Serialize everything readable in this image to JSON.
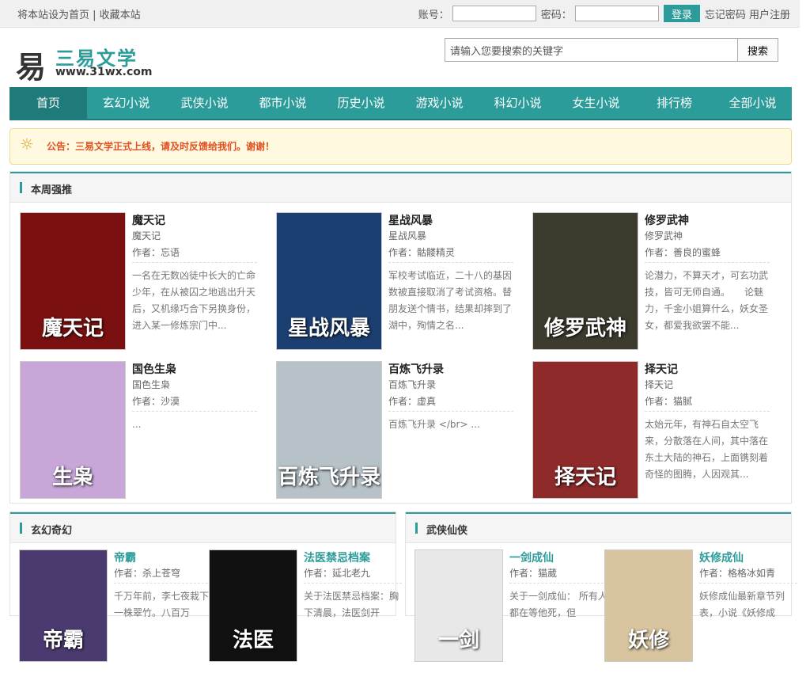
{
  "topbar": {
    "left_text_1": "将本站设为首页",
    "sep": " | ",
    "left_text_2": "收藏本站",
    "account_label": "账号：",
    "password_label": "密码：",
    "login_button": "登录",
    "forgot": "忘记密码",
    "register": "用户注册"
  },
  "logo": {
    "glyph": "易",
    "name": "三易文学",
    "url": "www.31wx.com"
  },
  "search": {
    "placeholder": "请输入您要搜索的关键字",
    "button": "搜索"
  },
  "nav": [
    "首页",
    "玄幻小说",
    "武侠小说",
    "都市小说",
    "历史小说",
    "游戏小说",
    "科幻小说",
    "女生小说",
    "排行榜",
    "全部小说"
  ],
  "notice": "公告：三易文学正式上线，请及时反馈给我们。谢谢！",
  "weekly": {
    "title": "本周强推",
    "books": [
      {
        "title": "魔天记",
        "sub": "魔天记",
        "author": "作者：忘语",
        "desc": "一名在无数凶徒中长大的亡命少年，在从被囚之地逃出升天后，又机缘巧合下另换身份，进入某一修炼宗门中...",
        "cover_text": "魔天记",
        "cover_color": "#7a1010"
      },
      {
        "title": "星战风暴",
        "sub": "星战风暴",
        "author": "作者：骷髅精灵",
        "desc": "军校考试临近，二十八的基因数被直接取消了考试资格。替朋友送个情书，结果却摔到了湖中，殉情之名...",
        "cover_text": "星战风暴",
        "cover_color": "#1c3f72"
      },
      {
        "title": "修罗武神",
        "sub": "修罗武神",
        "author": "作者：善良的蜜蜂",
        "desc": "论潜力，不算天才，可玄功武技，皆可无师自通。　　论魅力，千金小姐算什么，妖女圣女，都爱我欲罢不能...",
        "cover_text": "修罗武神",
        "cover_color": "#3d3a2e"
      },
      {
        "title": "国色生枭",
        "sub": "国色生枭",
        "author": "作者：沙漠",
        "desc": "...",
        "cover_text": "生枭",
        "cover_color": "#c8a7d8"
      },
      {
        "title": "百炼飞升录",
        "sub": "百炼飞升录",
        "author": "作者：虚真",
        "desc": "百炼飞升录 </br> ...",
        "cover_text": "百炼飞升录",
        "cover_color": "#b7c2c8"
      },
      {
        "title": "择天记",
        "sub": "择天记",
        "author": "作者：猫腻",
        "desc": "太始元年，有神石自太空飞来，分散落在人间，其中落在东土大陆的神石，上面镌刻着奇怪的图腾，人因观其...",
        "cover_text": "择天记",
        "cover_color": "#8e2a2a"
      }
    ]
  },
  "xuanhuan": {
    "title": "玄幻奇幻",
    "books": [
      {
        "title": "帝霸",
        "author": "作者：杀上苍穹",
        "desc": "千万年前，李七夜栽下一株翠竹。八百万",
        "cover_text": "帝霸",
        "cover_color": "#4b3a70"
      },
      {
        "title": "法医禁忌档案",
        "author": "作者：延北老九",
        "desc": "关于法医禁忌档案：胸下清晨，法医剑开",
        "cover_text": "法医",
        "cover_color": "#111111"
      }
    ]
  },
  "wuxia": {
    "title": "武侠仙侠",
    "books": [
      {
        "title": "一剑成仙",
        "author": "作者：猫葳",
        "desc": "关于一剑成仙： 所有人都在等他死，但",
        "cover_text": "一剑",
        "cover_color": "#e8e8e8"
      },
      {
        "title": "妖修成仙",
        "author": "作者：格格冰如青",
        "desc": "妖修成仙最新章节列表，小说《妖修成",
        "cover_text": "妖修",
        "cover_color": "#d9c4a0"
      }
    ]
  }
}
